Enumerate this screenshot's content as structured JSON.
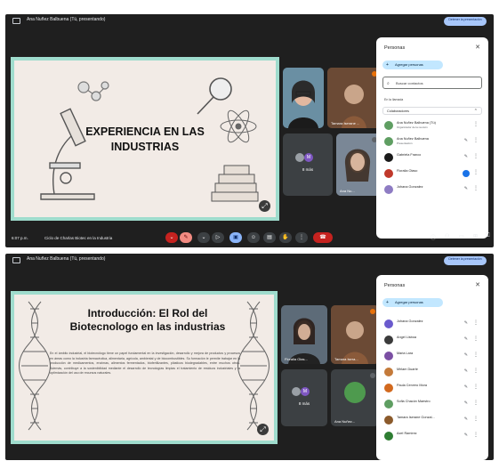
{
  "screens": [
    {
      "title": "Ana Nuñez Balbuena (Tú, presentando)",
      "stop_label": "Detener la presentación",
      "slide_title": "EXPERIENCIA EN LAS INDUSTRIAS",
      "tiles": [
        "Tamara Iserane ...",
        "8 más",
        "Ana Nu..."
      ],
      "time": "6:07 p.m.",
      "meeting": "Ciclo de Charlas Biotec en la Industria",
      "people": {
        "header": "Personas",
        "add": "Agregar personas",
        "search_placeholder": "Buscar contactos",
        "section": "En la llamada",
        "group": "Colaboradores",
        "list": [
          {
            "name": "Ana Nuñez Balbuena (Tú)",
            "sub": "Organizador de la reunión",
            "color": "#5f9e62"
          },
          {
            "name": "Ana Nuñez Balbuena",
            "sub": "Presentación",
            "color": "#5f9e62"
          },
          {
            "name": "Gabriela Franco",
            "sub": "",
            "color": "#1a1a1a"
          },
          {
            "name": "Floralia Olaso",
            "sub": "",
            "color": "#c0392b"
          },
          {
            "name": "Johana Gonzalez",
            "sub": "",
            "color": "#8e7cc3"
          }
        ]
      }
    },
    {
      "title": "Ana Nuñez Balbuena (Tú, presentando)",
      "stop_label": "Detener la presentación",
      "slide_title": "Introducción: El Rol del Biotecnologo en las industrias",
      "slide_body": "En el ámbito industrial, el biotecnólogo tiene un papel fundamental en la investigación, desarrollo y mejora de productos y procesos en áreas como la industria farmacéutica, alimentaria, agrícola, ambiental y de biocombustibles. Su formación le permite trabajar en la producción de medicamentos, enzimas, alimentos fermentados, biofertilizantes, plásticos biodegradables, entre muchos otros. Además, contribuye a la sostenibilidad mediante el desarrollo de tecnologías limpias el tratamiento de residuos industriales y la optimización del uso de recursos naturales.",
      "tiles": [
        "Floralia Olas...",
        "Tamara Isera...",
        "8 más",
        "Ana Nuñez..."
      ],
      "people": {
        "header": "Personas",
        "add": "Agregar personas",
        "list": [
          {
            "name": "Johana Gonzalez",
            "color": "#6a5acd"
          },
          {
            "name": "Angel Lisboa",
            "color": "#3b3b3b"
          },
          {
            "name": "Maria Lara",
            "color": "#7b4fa3"
          },
          {
            "name": "Mirlam Duarte",
            "color": "#c47a3a"
          },
          {
            "name": "Paula Cervero Mora",
            "color": "#d2691e"
          },
          {
            "name": "Sofia Chacón Maestro",
            "color": "#5f9e62"
          },
          {
            "name": "Tamara Iserane Gonzal...",
            "color": "#8b5a2b"
          },
          {
            "name": "Axel Ramirez",
            "color": "#2e7d32"
          }
        ]
      }
    }
  ]
}
